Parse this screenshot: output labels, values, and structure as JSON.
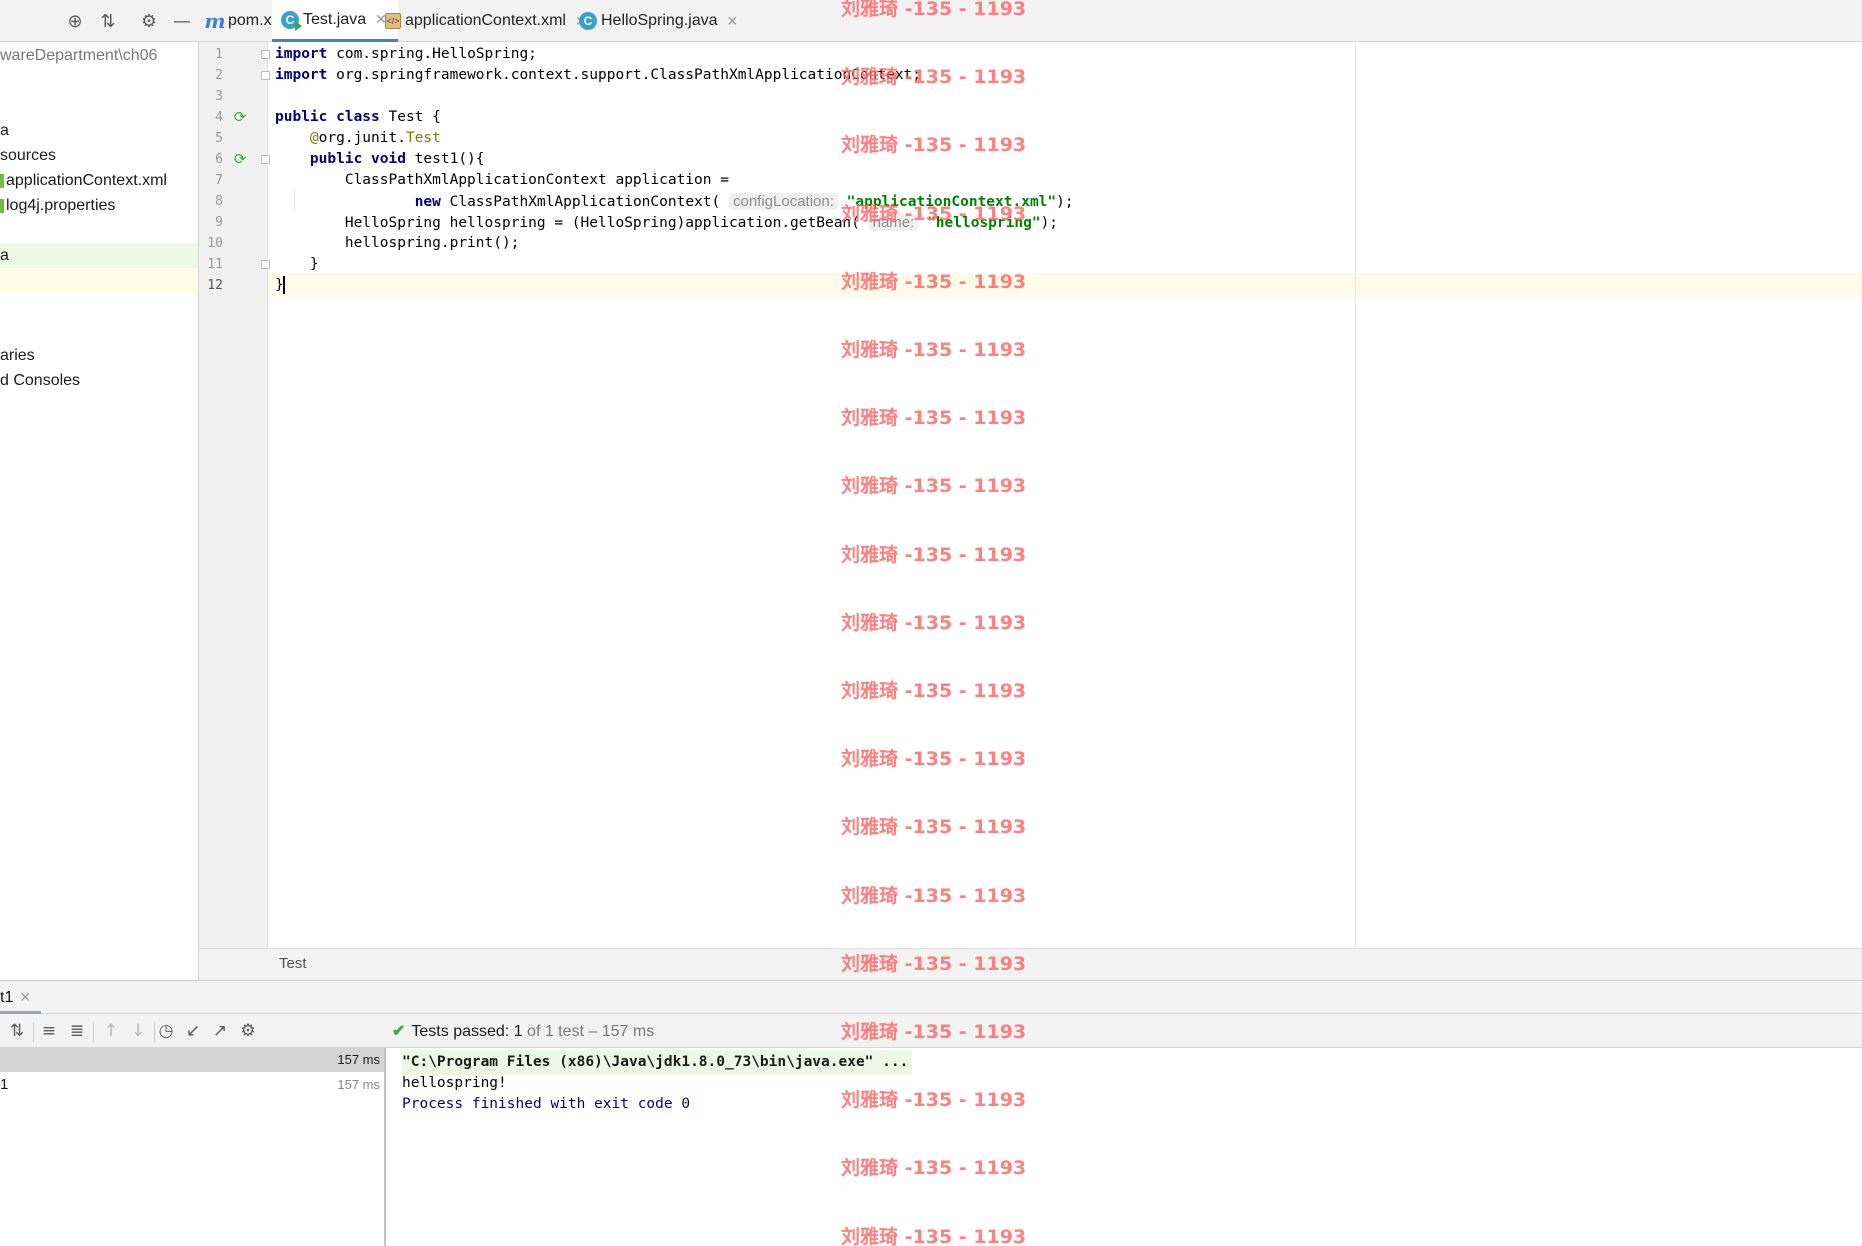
{
  "project_panel": {
    "toolbar_icons": [
      "locate-icon",
      "collapse-all-icon",
      "gear-icon",
      "minimize-icon"
    ],
    "tree": [
      {
        "label": "wareDepartment\\ch06",
        "muted": true
      },
      {
        "label": ""
      },
      {
        "label": ""
      },
      {
        "label": "a"
      },
      {
        "label": "sources"
      },
      {
        "label": "applicationContext.xml",
        "marked": true
      },
      {
        "label": "log4j.properties",
        "marked": true
      },
      {
        "label": ""
      },
      {
        "label": "a",
        "highlight": "green"
      },
      {
        "label": "",
        "highlight": "yellow"
      },
      {
        "label": ""
      },
      {
        "label": ""
      },
      {
        "label": "aries"
      },
      {
        "label": "d Consoles"
      }
    ]
  },
  "editor_tabs": [
    {
      "label": "pom.xml",
      "icon": "maven-icon",
      "active": false
    },
    {
      "label": "Test.java",
      "icon": "java-test-class-icon",
      "active": true
    },
    {
      "label": "applicationContext.xml",
      "icon": "spring-xml-icon",
      "active": false
    },
    {
      "label": "HelloSpring.java",
      "icon": "java-class-icon",
      "active": false
    }
  ],
  "code": {
    "line_numbers": [
      "1",
      "2",
      "3",
      "4",
      "5",
      "6",
      "7",
      "8",
      "9",
      "10",
      "11",
      "12"
    ],
    "current_line": "12",
    "lines": [
      [
        {
          "t": "import",
          "c": "kw"
        },
        {
          "t": " com.spring.HelloSpring;"
        }
      ],
      [
        {
          "t": "import",
          "c": "kw"
        },
        {
          "t": " org.springframework.context.support.ClassPathXmlApplicationContext;"
        }
      ],
      [],
      [
        {
          "t": "public class",
          "c": "kw"
        },
        {
          "t": " Test {"
        }
      ],
      [
        {
          "t": "    @",
          "c": "ann"
        },
        {
          "t": "org.junit."
        },
        {
          "t": "Test",
          "c": "ann"
        }
      ],
      [
        {
          "t": "    "
        },
        {
          "t": "public void",
          "c": "kw"
        },
        {
          "t": " test1(){"
        }
      ],
      [
        {
          "t": "        ClassPathXmlApplicationContext application ="
        }
      ],
      [
        {
          "t": "                "
        },
        {
          "t": "new",
          "c": "kw"
        },
        {
          "t": " ClassPathXmlApplicationContext( "
        },
        {
          "t": "configLocation:",
          "c": "hint"
        },
        {
          "t": " "
        },
        {
          "t": "\"applicationContext.xml\"",
          "c": "str"
        },
        {
          "t": ");"
        }
      ],
      [
        {
          "t": "        HelloSpring hellospring = (HelloSpring)application.getBean( "
        },
        {
          "t": "name:",
          "c": "hint"
        },
        {
          "t": " "
        },
        {
          "t": "\"hellospring\"",
          "c": "str"
        },
        {
          "t": ");"
        }
      ],
      [
        {
          "t": "        hellospring.print();"
        }
      ],
      [
        {
          "t": "    }"
        }
      ],
      [
        {
          "t": "}"
        }
      ]
    ]
  },
  "breadcrumb": "Test",
  "run_panel": {
    "tab_label": "t1",
    "toolbar_icons": [
      "sort-icon",
      "expand-all-icon",
      "collapse-all-icon",
      "up-arrow-icon",
      "down-arrow-icon",
      "history-icon",
      "import-icon",
      "export-icon",
      "gear-icon"
    ],
    "status": {
      "prefix": "Tests passed: ",
      "passed": "1",
      "rest": "of 1 test – 157 ms"
    },
    "tests": [
      {
        "label": "",
        "duration": "157 ms",
        "selected": true
      },
      {
        "label": "1",
        "duration": "157 ms",
        "selected": false
      }
    ],
    "console": {
      "command": "\"C:\\Program Files (x86)\\Java\\jdk1.8.0_73\\bin\\java.exe\" ...",
      "output": "hellospring!",
      "exit": "Process finished with exit code 0"
    }
  },
  "watermark": "刘雅琦 -135 - 1193"
}
